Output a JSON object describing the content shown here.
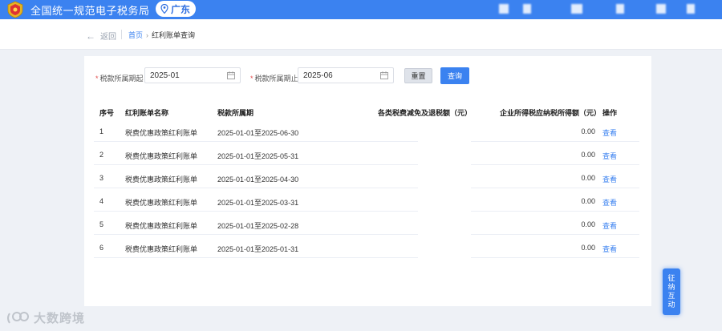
{
  "header": {
    "site_title": "全国统一规范电子税务局",
    "region": "广东"
  },
  "subheader": {
    "back_label": "返回",
    "breadcrumb_home": "首页",
    "breadcrumb_sep": "›",
    "breadcrumb_current": "红利账单查询"
  },
  "filters": {
    "start_label": "税款所属期起",
    "start_value": "2025-01",
    "end_label": "税款所属期止",
    "end_value": "2025-06",
    "reset_label": "重置",
    "query_label": "查询"
  },
  "table": {
    "headers": {
      "index": "序号",
      "name": "红利账单名称",
      "period": "税款所属期",
      "reduction": "各类税费减免及退税额（元）",
      "income_tax": "企业所得税应纳税所得额（元）",
      "action": "操作"
    },
    "rows": [
      {
        "index": "1",
        "name": "税费优惠政策红利账单",
        "period": "2025-01-01至2025-06-30",
        "income_tax": "0.00",
        "action": "查看"
      },
      {
        "index": "2",
        "name": "税费优惠政策红利账单",
        "period": "2025-01-01至2025-05-31",
        "income_tax": "0.00",
        "action": "查看"
      },
      {
        "index": "3",
        "name": "税费优惠政策红利账单",
        "period": "2025-01-01至2025-04-30",
        "income_tax": "0.00",
        "action": "查看"
      },
      {
        "index": "4",
        "name": "税费优惠政策红利账单",
        "period": "2025-01-01至2025-03-31",
        "income_tax": "0.00",
        "action": "查看"
      },
      {
        "index": "5",
        "name": "税费优惠政策红利账单",
        "period": "2025-01-01至2025-02-28",
        "income_tax": "0.00",
        "action": "查看"
      },
      {
        "index": "6",
        "name": "税费优惠政策红利账单",
        "period": "2025-01-01至2025-01-31",
        "income_tax": "0.00",
        "action": "查看"
      }
    ]
  },
  "side_tab": {
    "chars": [
      "征",
      "纳",
      "互",
      "动"
    ]
  },
  "watermark": {
    "text": "大数跨境"
  },
  "colors": {
    "primary": "#3b82f0",
    "required": "#e34d4d"
  },
  "icons": {
    "logo": "tax-emblem-icon",
    "region": "location-pin-icon",
    "date": "calendar-icon",
    "back": "arrow-left-icon"
  }
}
